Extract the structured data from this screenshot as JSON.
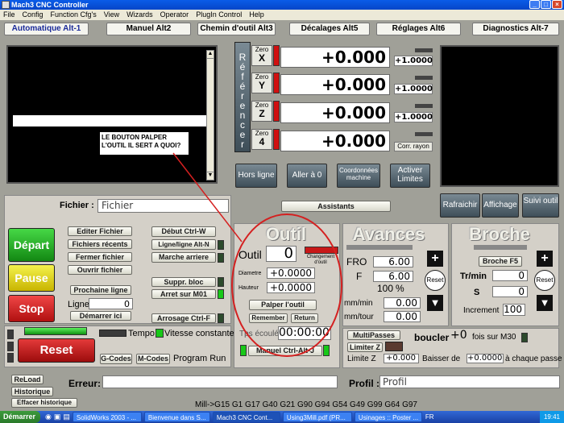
{
  "window": {
    "title": "Mach3 CNC Controller"
  },
  "menu": [
    "File",
    "Config",
    "Function Cfg's",
    "View",
    "Wizards",
    "Operator",
    "PlugIn Control",
    "Help"
  ],
  "tabs": [
    "Automatique Alt-1",
    "Manuel Alt2",
    "Chemin d'outil Alt3",
    "Décalages Alt5",
    "Réglages Alt6",
    "Diagnostics Alt-7"
  ],
  "annotation": "LE BOUTON PALPER L'OUTIL IL SERT A QUOI?",
  "reference_label": "Référencer",
  "axes": [
    {
      "zero": "Zero",
      "axis": "X",
      "value": "+0.000",
      "scale": "+1.0000"
    },
    {
      "zero": "Zero",
      "axis": "Y",
      "value": "+0.000",
      "scale": "+1.0000"
    },
    {
      "zero": "Zero",
      "axis": "Z",
      "value": "+0.000",
      "scale": "+1.0000"
    },
    {
      "zero": "Zero",
      "axis": "4",
      "value": "+0.000",
      "scale": "Corr. rayon"
    }
  ],
  "dro_buttons": [
    "Hors ligne",
    "Aller à 0",
    "Coordonnées machine",
    "Activer Limites"
  ],
  "assistants": "Assistants",
  "right_buttons": [
    "Rafraichir",
    "Affichage",
    "Suivi outil"
  ],
  "fichier": {
    "label": "Fichier :",
    "value": "Fichier"
  },
  "cycle": {
    "depart": "Départ",
    "pause": "Pause",
    "stop": "Stop"
  },
  "file_buttons": [
    "Editer Fichier",
    "Fichiers récents",
    "Fermer fichier",
    "Ouvrir fichier"
  ],
  "run_buttons": [
    "Début Ctrl-W",
    "Ligne/ligne Alt-N",
    "Marche arriere"
  ],
  "prochaine_ligne": "Prochaine ligne",
  "ligne": {
    "label": "Ligne:",
    "value": "0"
  },
  "demarrer_ici": "Démarrer ici",
  "suppr_bloc": "Suppr. bloc",
  "arret_m01": "Arret sur M01",
  "arrosage": "Arrosage Ctrl-F",
  "reset": "Reset",
  "tempo": "Tempo",
  "vitesse_constante": "Vitesse constante",
  "gcodes": "G-Codes",
  "mcodes": "M-Codes",
  "program_run": "Program Run",
  "outil": {
    "title": "Outil",
    "label": "Outil",
    "value": "0",
    "changement": "Changement d'outil",
    "diametre_label": "Diametre",
    "diametre": "+0.0000",
    "hauteur_label": "Hauteur",
    "hauteur": "+0.0000",
    "palper": "Palper l'outil",
    "remember": "Remember",
    "return": "Return",
    "tps_label": "Tps écoulé",
    "tps": "00:00:00",
    "manuel": "Manuel Ctrl-Alt-J"
  },
  "avances": {
    "title": "Avances",
    "fro_label": "FRO",
    "fro": "6.00",
    "f_label": "F",
    "f": "6.00",
    "pct": "100",
    "pct_unit": "%",
    "mmmin_label": "mm/min",
    "mmmin": "0.00",
    "mmtour_label": "mm/tour",
    "mmtour": "0.00",
    "reset": "Reset"
  },
  "broche": {
    "title": "Broche",
    "f5": "Broche F5",
    "trmin_label": "Tr/min",
    "trmin": "0",
    "s_label": "S",
    "s": "0",
    "inc_label": "Increment",
    "inc": "100",
    "reset": "Reset"
  },
  "multipasses": "MultiPasses",
  "limiter_z": "Limiter Z",
  "boucler": {
    "label": "boucler",
    "value": "+0",
    "suffix": "fois sur M30"
  },
  "limite_z": {
    "label": "Limite Z",
    "value": "+0.000"
  },
  "baisser": {
    "label": "Baisser de",
    "value": "+0.0000",
    "suffix": "à chaque passe"
  },
  "reload": "ReLoad",
  "historique": "Historique",
  "effacer": "Effacer historique",
  "erreur_label": "Erreur:",
  "profil": {
    "label": "Profil :",
    "value": "Profil"
  },
  "status_line": "Mill->G15  G1 G17 G40 G21 G90 G94 G54 G49 G99 G64 G97",
  "taskbar": {
    "start": "Démarrer",
    "items": [
      "SolidWorks 2003 - ...",
      "Bienvenue dans S...",
      "Mach3 CNC Cont...",
      "Using3Mill.pdf (PR...",
      "Usinages :: Poster ..."
    ],
    "lang": "FR",
    "time": "19:41"
  }
}
